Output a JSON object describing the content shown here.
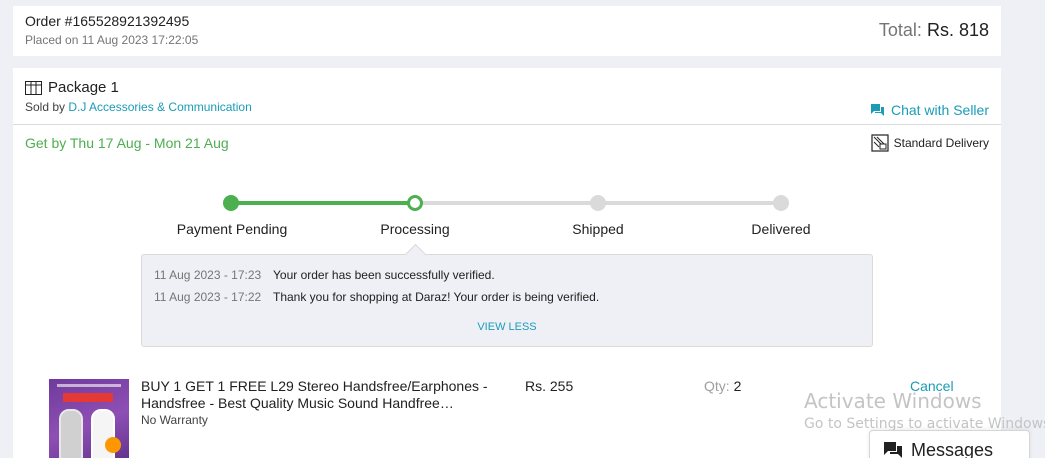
{
  "order": {
    "number": "Order #165528921392495",
    "placed_on": "Placed on 11 Aug 2023 17:22:05",
    "total_label": "Total:",
    "total_amount": "Rs. 818"
  },
  "package": {
    "title": "Package 1",
    "sold_by_label": "Sold by",
    "seller_name": "D.J Accessories & Communication",
    "chat_label": "Chat with Seller",
    "get_by": "Get by Thu 17 Aug - Mon 21 Aug",
    "delivery_type": "Standard Delivery"
  },
  "steps": [
    {
      "label": "Payment Pending",
      "state": "done"
    },
    {
      "label": "Processing",
      "state": "current"
    },
    {
      "label": "Shipped",
      "state": "todo"
    },
    {
      "label": "Delivered",
      "state": "todo"
    }
  ],
  "log": {
    "entries": [
      {
        "time": "11 Aug 2023 - 17:23",
        "message": "Your order has been successfully verified."
      },
      {
        "time": "11 Aug 2023 - 17:22",
        "message": "Thank you for shopping at Daraz! Your order is being verified."
      }
    ],
    "toggle_label": "VIEW LESS"
  },
  "item": {
    "title": "BUY 1 GET 1 FREE L29 Stereo Handsfree/Earphones - Handsfree - Best Quality Music Sound Handfree…",
    "warranty": "No Warranty",
    "price": "Rs. 255",
    "qty_label": "Qty:",
    "qty_value": "2",
    "cancel_label": "Cancel"
  },
  "overlay": {
    "activate_title": "Activate Windows",
    "activate_sub": "Go to Settings to activate Windows."
  },
  "messages_widget": {
    "label": "Messages",
    "icon": "chat-bubbles-icon"
  },
  "colors": {
    "accent": "#1a9cb7",
    "success": "#4caf50",
    "inactive": "#dadada"
  }
}
